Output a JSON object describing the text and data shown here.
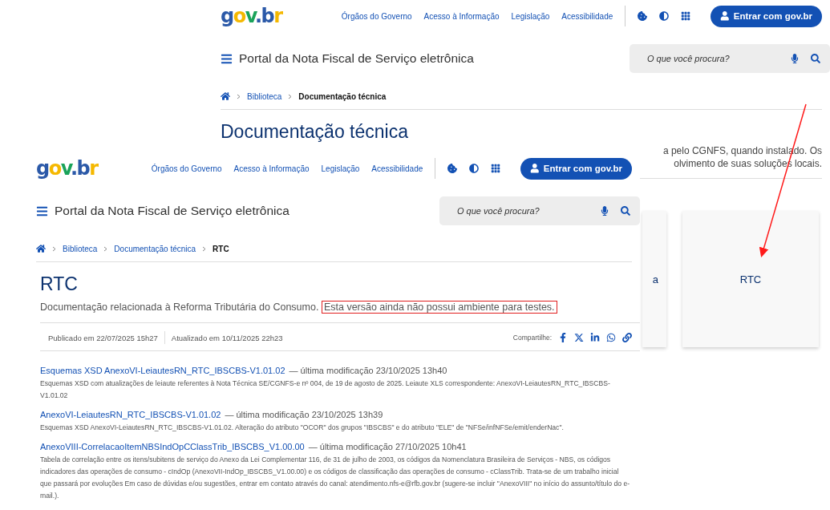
{
  "back_page": {
    "logo": "gov.br",
    "nav_links": [
      "Órgãos do Governo",
      "Acesso à Informação",
      "Legislação",
      "Acessibilidade"
    ],
    "login_button": "Entrar com gov.br",
    "portal_title": "Portal da Nota Fiscal de Serviço eletrônica",
    "search": {
      "placeholder": "O que você procura?"
    },
    "breadcrumb": [
      {
        "label": "Biblioteca",
        "current": false
      },
      {
        "label": "Documentação técnica",
        "current": true
      }
    ],
    "title": "Documentação técnica",
    "description_lines": [
      "a pelo CGNFS, quando instalado. Os",
      "olvimento de suas soluções locais."
    ],
    "cards": [
      {
        "label": "a"
      },
      {
        "label": "RTC"
      }
    ]
  },
  "front_page": {
    "logo": "gov.br",
    "nav_links": [
      "Órgãos do Governo",
      "Acesso à Informação",
      "Legislação",
      "Acessibilidade"
    ],
    "login_button": "Entrar com gov.br",
    "portal_title": "Portal da Nota Fiscal de Serviço eletrônica",
    "search": {
      "placeholder": "O que você procura?"
    },
    "breadcrumb": [
      {
        "label": "Biblioteca",
        "current": false
      },
      {
        "label": "Documentação técnica",
        "current": false
      },
      {
        "label": "RTC",
        "current": true
      }
    ],
    "title": "RTC",
    "description": "Documentação relacionada à Reforma Tributária do Consumo.",
    "highlighted_note": "Esta versão ainda não possui ambiente para testes.",
    "published": "Publicado em 22/07/2025 15h27",
    "updated": "Atualizado em 10/11/2025 22h23",
    "share_label": "Compartilhe:",
    "documents": [
      {
        "link": "Esquemas XSD AnexoVI-LeiautesRN_RTC_IBSCBS-V1.01.02",
        "modified": "— última modificação 23/10/2025 13h40",
        "description": "Esquemas XSD com atualizações de leiaute referentes à Nota Técnica SE/CGNFS-e nº 004, de 19 de agosto de 2025. Leiaute XLS correspondente: AnexoVI-LeiautesRN_RTC_IBSCBS-V1.01.02"
      },
      {
        "link": "AnexoVI-LeiautesRN_RTC_IBSCBS-V1.01.02",
        "modified": "— última modificação 23/10/2025 13h39",
        "description": "Esquemas XSD AnexoVI-LeiautesRN_RTC_IBSCBS-V1.01.02. Alteração do atributo \"OCOR\" dos grupos \"IBSCBS\" e do atributo \"ELE\" de \"NFSe/infNFSe/emit/enderNac\"."
      },
      {
        "link": "AnexoVIII-CorrelacaoItemNBSIndOpCClassTrib_IBSCBS_V1.00.00",
        "modified": "— última modificação 27/10/2025 10h41",
        "description": "Tabela de correlação entre os itens/subitens de serviço do Anexo da Lei Complementar 116, de 31 de julho de 2003, os códigos da Nomenclatura Brasileira de Serviços - NBS, os códigos indicadores das operações de consumo - cIndOp (AnexoVII-IndOp_IBSCBS_V1.00.00) e os códigos de classificação das operações de consumo - cClassTrib. Trata-se de um trabalho inicial que passará por evoluções Em caso de dúvidas e/ou sugestões, entrar em contato através do canal: atendimento.nfs-e@rfb.gov.br (sugere-se incluir \"AnexoVIII\" no início do assunto/título do e-mail.)."
      }
    ]
  }
}
